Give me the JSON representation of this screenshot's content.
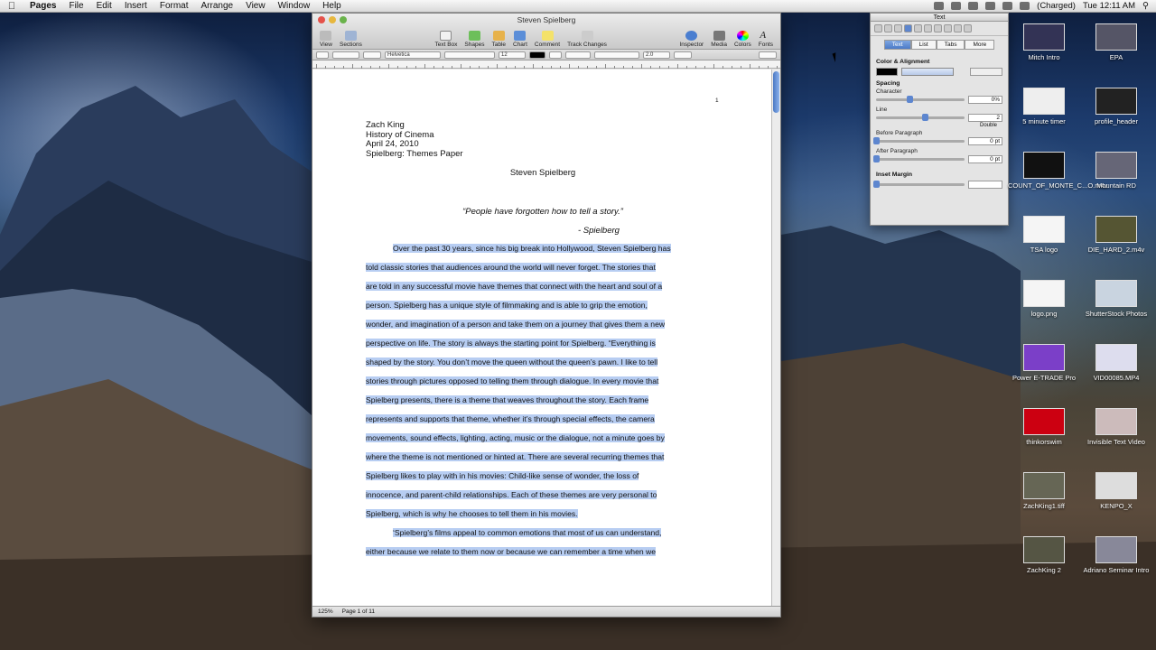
{
  "menubar": {
    "app": "Pages",
    "items": [
      "File",
      "Edit",
      "Insert",
      "Format",
      "Arrange",
      "View",
      "Window",
      "Help"
    ],
    "battery": "(Charged)",
    "clock": "Tue 12:11 AM"
  },
  "window": {
    "title": "Steven Spielberg",
    "toolbar": {
      "left": [
        "View",
        "Sections"
      ],
      "center": [
        "Text Box",
        "Shapes",
        "Table",
        "Chart",
        "Comment",
        "Track Changes"
      ],
      "right": [
        "Inspector",
        "Media",
        "Colors",
        "Fonts"
      ]
    },
    "format": {
      "font": "Helvetica",
      "size": "12",
      "spacing": "2.0"
    },
    "page_number": "1",
    "header_lines": [
      "Zach King",
      "History of Cinema",
      "April 24, 2010",
      "Spielberg: Themes Paper"
    ],
    "quote": "“People have forgotten how to tell a story.”",
    "attribution": "- Spielberg",
    "body_lines": [
      {
        "t": "Over the past 30 years, since his big break into Hollywood, Steven Spielberg has",
        "indent": true
      },
      {
        "t": "told classic stories that audiences around the world will never forget. The stories that"
      },
      {
        "t": "are told in any successful movie have themes that connect with the heart and soul of a"
      },
      {
        "t": "person. Spielberg has a unique style of filmmaking and is able to grip the emotion,"
      },
      {
        "t": "wonder, and imagination of a person and take them on a journey that gives them a new"
      },
      {
        "t": "perspective on life. The story is always the starting point for Spielberg. “Everything is"
      },
      {
        "t": "shaped by the story. You don’t move the queen without the queen’s pawn. I like to tell"
      },
      {
        "t": "stories through pictures opposed to telling them through dialogue. In every movie that"
      },
      {
        "t": "Spielberg presents, there is a theme that weaves throughout the story. Each frame"
      },
      {
        "t": "represents and supports that theme, whether it’s through special effects, the camera"
      },
      {
        "t": "movements, sound effects, lighting, acting, music or the dialogue, not a minute goes by"
      },
      {
        "t": "where the theme is not mentioned or hinted at. There are several recurring themes that"
      },
      {
        "t": "Spielberg likes to play with in his movies: Child-like sense of wonder, the loss of"
      },
      {
        "t": "innocence, and parent-child relationships. Each of these themes are very personal to"
      },
      {
        "t": "Spielberg, which is why he chooses to tell them in his movies."
      },
      {
        "t": "‘Spielberg’s films appeal to common emotions that most of us can understand,",
        "indent": true
      },
      {
        "t": "either because we relate to them now or because we can remember a time when we"
      }
    ],
    "status": {
      "zoom": "125%",
      "page": "Page 1 of 11"
    }
  },
  "inspector": {
    "title": "Text",
    "tabs": [
      "Text",
      "List",
      "Tabs",
      "More"
    ],
    "active_tab": "Text",
    "color_alignment": "Color & Alignment",
    "spacing": "Spacing",
    "character": {
      "label": "Character",
      "value": "0%",
      "fill": 0.38
    },
    "line": {
      "label": "Line",
      "value": "2",
      "mode": "Double",
      "fill": 0.55
    },
    "before": {
      "label": "Before Paragraph",
      "value": "0 pt",
      "fill": 0
    },
    "after": {
      "label": "After Paragraph",
      "value": "0 pt",
      "fill": 0
    },
    "inset": {
      "label": "Inset Margin",
      "fill": 0
    }
  },
  "desktop_icons": [
    "Mitch Intro",
    "EPA",
    "5 minute timer",
    "profile_header",
    "COUNT_OF_MONTE_C...O.m4v",
    "Mountain RD",
    "TSA logo",
    "DIE_HARD_2.m4v",
    "logo.png",
    "ShutterStock Photos",
    "Power E-TRADE Pro",
    "VID00085.MP4",
    "thinkorswim",
    "Invisible Text Video",
    "ZachKing1.tiff",
    "KENPO_X",
    "ZachKing 2",
    "Adriano Seminar Intro"
  ],
  "colors": {
    "selection": "#b7cdf2",
    "accent": "#4b7bc8"
  }
}
